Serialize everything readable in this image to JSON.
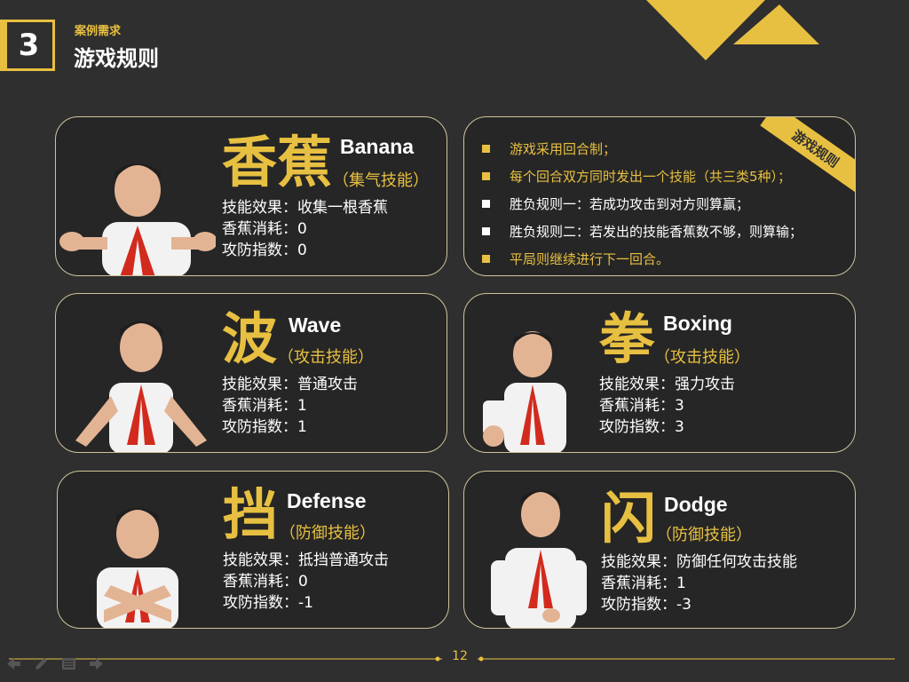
{
  "header": {
    "number": "3",
    "subtitle": "案例需求",
    "title": "游戏规则"
  },
  "rules": {
    "tag": "游戏规则",
    "items": [
      {
        "text": "游戏采用回合制；",
        "color": "#e8c041"
      },
      {
        "text": "每个回合双方同时发出一个技能（共三类5种）；",
        "color": "#e8c041"
      },
      {
        "text": "胜负规则一：若成功攻击到对方则算赢；",
        "color": "#ffffff"
      },
      {
        "text": "胜负规则二：若发出的技能香蕉数不够，则算输；",
        "color": "#ffffff"
      },
      {
        "text": "平局则继续进行下一回合。",
        "color": "#e8c041"
      }
    ]
  },
  "skills": [
    {
      "char": "香蕉",
      "en": "Banana",
      "type": "（集气技能）",
      "effect": "技能效果：收集一根香蕉",
      "cost": "香蕉消耗：0",
      "power": "攻防指数：0"
    },
    {
      "char": "波",
      "en": "Wave",
      "type": "（攻击技能）",
      "effect": "技能效果：普通攻击",
      "cost": "香蕉消耗：1",
      "power": "攻防指数：1"
    },
    {
      "char": "拳",
      "en": "Boxing",
      "type": "（攻击技能）",
      "effect": "技能效果：强力攻击",
      "cost": "香蕉消耗：3",
      "power": "攻防指数：3"
    },
    {
      "char": "挡",
      "en": "Defense",
      "type": "（防御技能）",
      "effect": "技能效果：抵挡普通攻击",
      "cost": "香蕉消耗：0",
      "power": "攻防指数：-1"
    },
    {
      "char": "闪",
      "en": "Dodge",
      "type": "（防御技能）",
      "effect": "技能效果：防御任何攻击技能",
      "cost": "香蕉消耗：1",
      "power": "攻防指数：-3"
    }
  ],
  "footer": {
    "page": "12"
  },
  "colors": {
    "accent": "#e8c041",
    "background": "#2f2f2f",
    "card": "#262626",
    "text": "#ffffff"
  }
}
